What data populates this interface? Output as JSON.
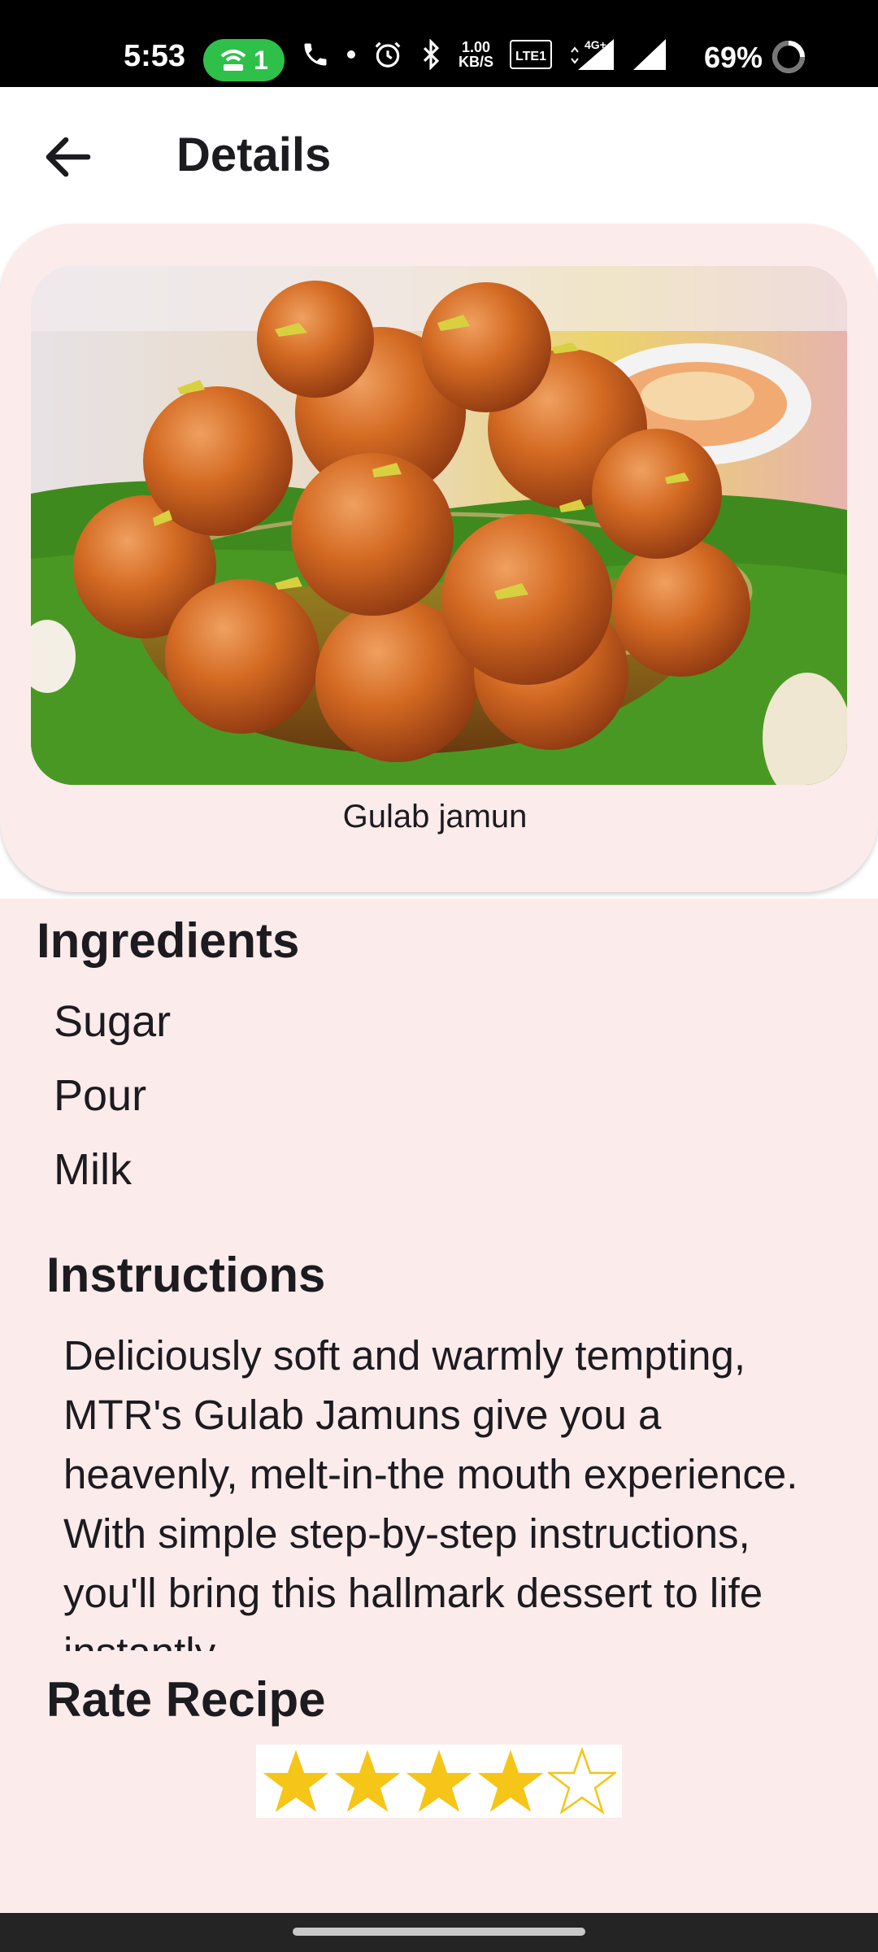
{
  "status_bar": {
    "time": "5:53",
    "hotspot_count": "1",
    "data_speed_top": "1.00",
    "data_speed_bottom": "KB/S",
    "network": "4G+",
    "battery": "69%",
    "icons": [
      "hotspot-icon",
      "phone-icon",
      "dot-icon",
      "alarm-icon",
      "bluetooth-icon",
      "volte-icon",
      "signal-4g-icon",
      "signal-icon",
      "battery-icon"
    ]
  },
  "app_bar": {
    "title": "Details",
    "back_icon": "arrow-back-icon"
  },
  "recipe": {
    "name": "Gulab jamun",
    "image": "gulab-jamun-photo"
  },
  "ingredients": {
    "title": "Ingredients",
    "items": [
      "Sugar",
      "Pour",
      "Milk"
    ]
  },
  "instructions": {
    "title": "Instructions",
    "text": "Deliciously soft and warmly tempting, MTR's Gulab Jamuns give you a heavenly, melt-in-the mouth experience. With simple step-by-step instructions, you'll bring this hallmark dessert to life instantly."
  },
  "rating": {
    "title": "Rate Recipe",
    "value": 4,
    "max": 5,
    "star_color": "#f5c518"
  },
  "colors": {
    "background": "#fcebeb",
    "app_bar": "#ffffff",
    "status_bar": "#000000",
    "hotspot_badge": "#2fc04a"
  }
}
